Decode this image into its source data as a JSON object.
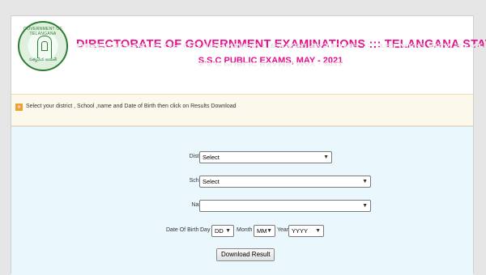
{
  "emblem": {
    "ring_text": "GOVERNMENT OF TELANGANA",
    "bottom_text": "సత్యమేవ జయతే"
  },
  "header": {
    "title": "DIRECTORATE OF GOVERNMENT EXAMINATIONS ::: TELANGANA STATE",
    "subtitle": "S.S.C PUBLIC EXAMS, MAY - 2021"
  },
  "notice": {
    "icon": "»",
    "text": "Select your district , School ,name  and Date of Birth then click on Results Download"
  },
  "form": {
    "district": {
      "label": "District:",
      "value": "Select"
    },
    "school": {
      "label": "School:",
      "value": "Select"
    },
    "name": {
      "label": "Name:",
      "value": ""
    },
    "dob": {
      "label": "Date Of Birth :",
      "day_label": "Day :",
      "day_value": "DD",
      "month_label": "Month :",
      "month_value": "MM",
      "year_label": "Year :",
      "year_value": "YYYY"
    },
    "submit_label": "Download Result"
  }
}
